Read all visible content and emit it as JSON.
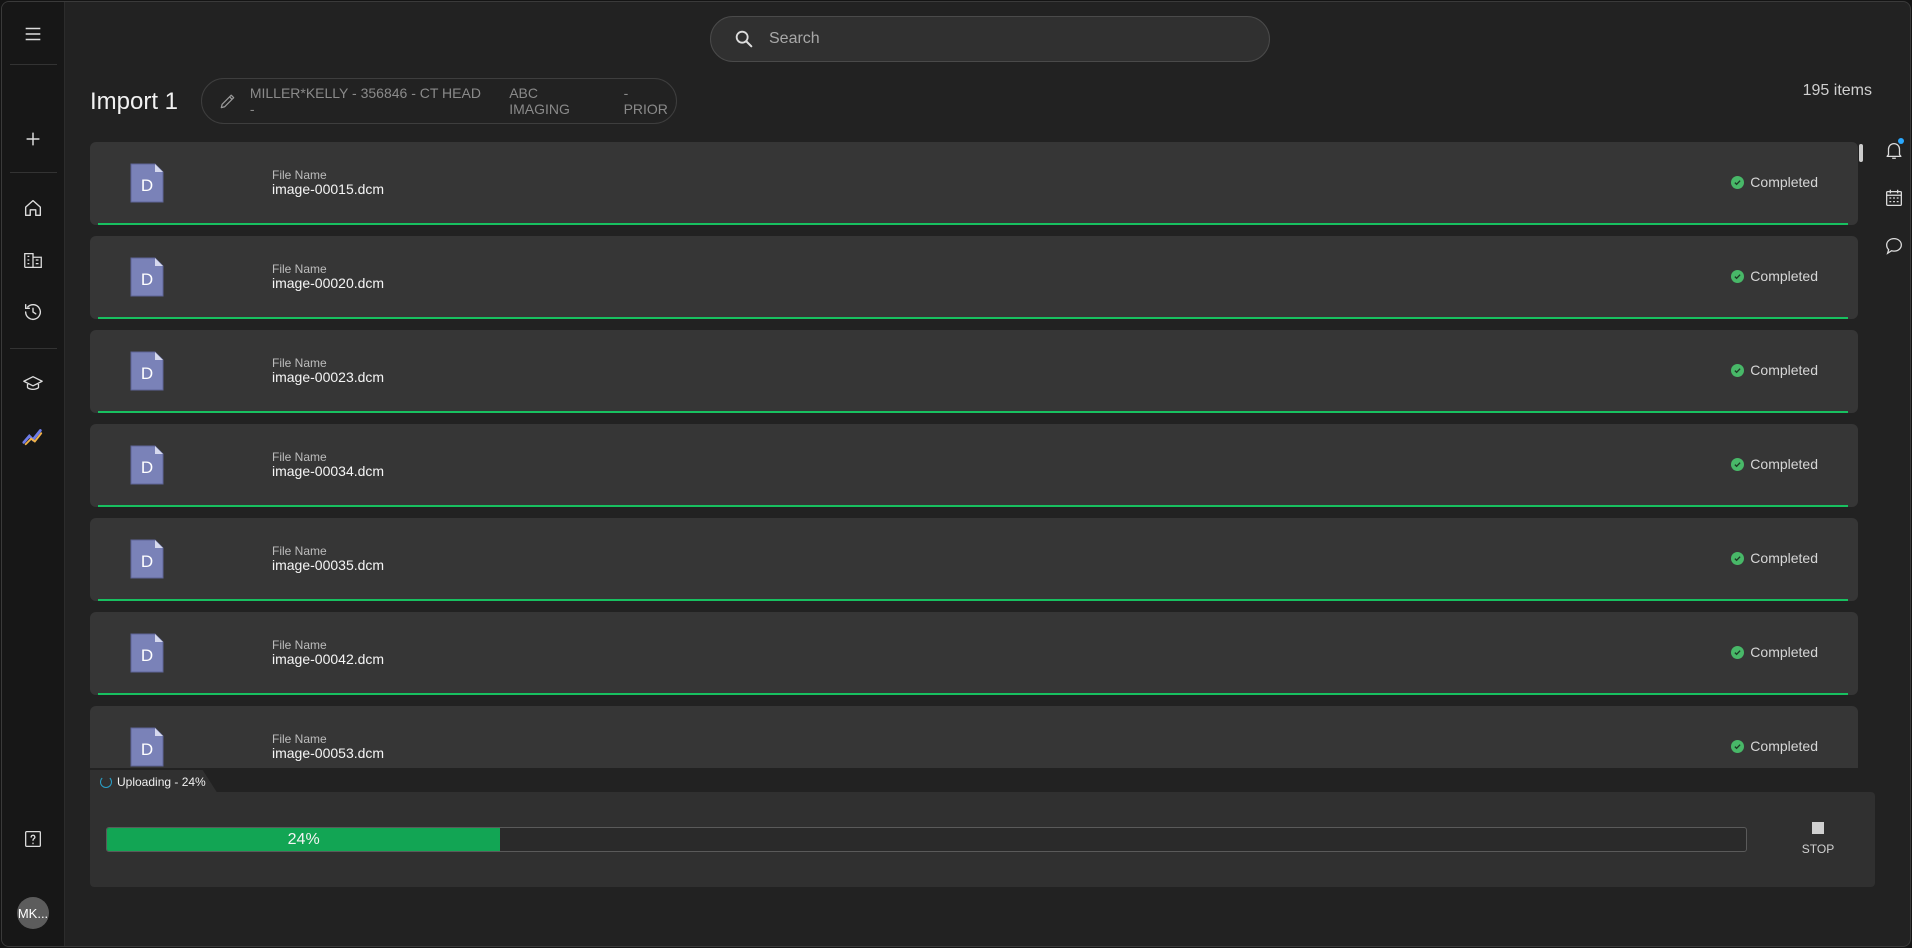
{
  "sidebar": {
    "items": [
      {
        "name": "menu-icon"
      },
      {
        "name": "add-icon"
      },
      {
        "name": "home-icon"
      },
      {
        "name": "organization-icon"
      },
      {
        "name": "history-icon"
      },
      {
        "name": "education-icon"
      },
      {
        "name": "analytics-icon"
      },
      {
        "name": "help-icon"
      }
    ],
    "avatar": "MK..."
  },
  "search": {
    "placeholder": "Search"
  },
  "header": {
    "title": "Import 1",
    "study_parts": [
      "MILLER*KELLY - 356846 - CT HEAD -",
      "ABC IMAGING",
      "- PRIOR"
    ],
    "item_count": "195 items"
  },
  "files": [
    {
      "label": "File Name",
      "name": "image-00015.dcm",
      "status": "Completed",
      "icon_letter": "D"
    },
    {
      "label": "File Name",
      "name": "image-00020.dcm",
      "status": "Completed",
      "icon_letter": "D"
    },
    {
      "label": "File Name",
      "name": "image-00023.dcm",
      "status": "Completed",
      "icon_letter": "D"
    },
    {
      "label": "File Name",
      "name": "image-00034.dcm",
      "status": "Completed",
      "icon_letter": "D"
    },
    {
      "label": "File Name",
      "name": "image-00035.dcm",
      "status": "Completed",
      "icon_letter": "D"
    },
    {
      "label": "File Name",
      "name": "image-00042.dcm",
      "status": "Completed",
      "icon_letter": "D"
    },
    {
      "label": "File Name",
      "name": "image-00053.dcm",
      "status": "Completed",
      "icon_letter": "D"
    }
  ],
  "upload": {
    "tab_label": "Uploading - 24%",
    "progress_fraction": 0.24,
    "progress_label": "24%",
    "stop_label": "STOP"
  },
  "colors": {
    "accent_green": "#12a554",
    "completed_line": "#18c060",
    "status_dot": "#48b868",
    "notification_dot": "#29a8ff"
  }
}
